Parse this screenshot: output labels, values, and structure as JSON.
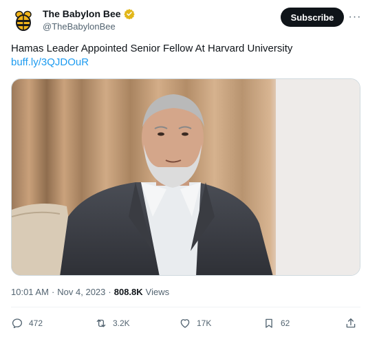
{
  "author": {
    "display_name": "The Babylon Bee",
    "handle": "@TheBabylonBee"
  },
  "header": {
    "subscribe_label": "Subscribe",
    "more_label": "···"
  },
  "tweet": {
    "text": "Hamas Leader Appointed Senior Fellow At Harvard University",
    "link": "buff.ly/3QJDOuR"
  },
  "meta": {
    "time": "10:01 AM",
    "separator": "·",
    "date": "Nov 4, 2023",
    "separator2": "·",
    "views_count": "808.8K",
    "views_label": "Views"
  },
  "actions": {
    "replies": "472",
    "reposts": "3.2K",
    "likes": "17K",
    "bookmarks": "62"
  },
  "colors": {
    "text": "#0f1419",
    "secondary": "#536471",
    "link": "#1d9bf0",
    "verified": "#e2b719",
    "button": "#0f1419"
  },
  "icons": {
    "avatar": "bee-logo-icon",
    "verified": "verified-badge-icon",
    "reply": "reply-icon",
    "repost": "repost-icon",
    "like": "heart-icon",
    "bookmark": "bookmark-icon",
    "share": "share-icon"
  }
}
